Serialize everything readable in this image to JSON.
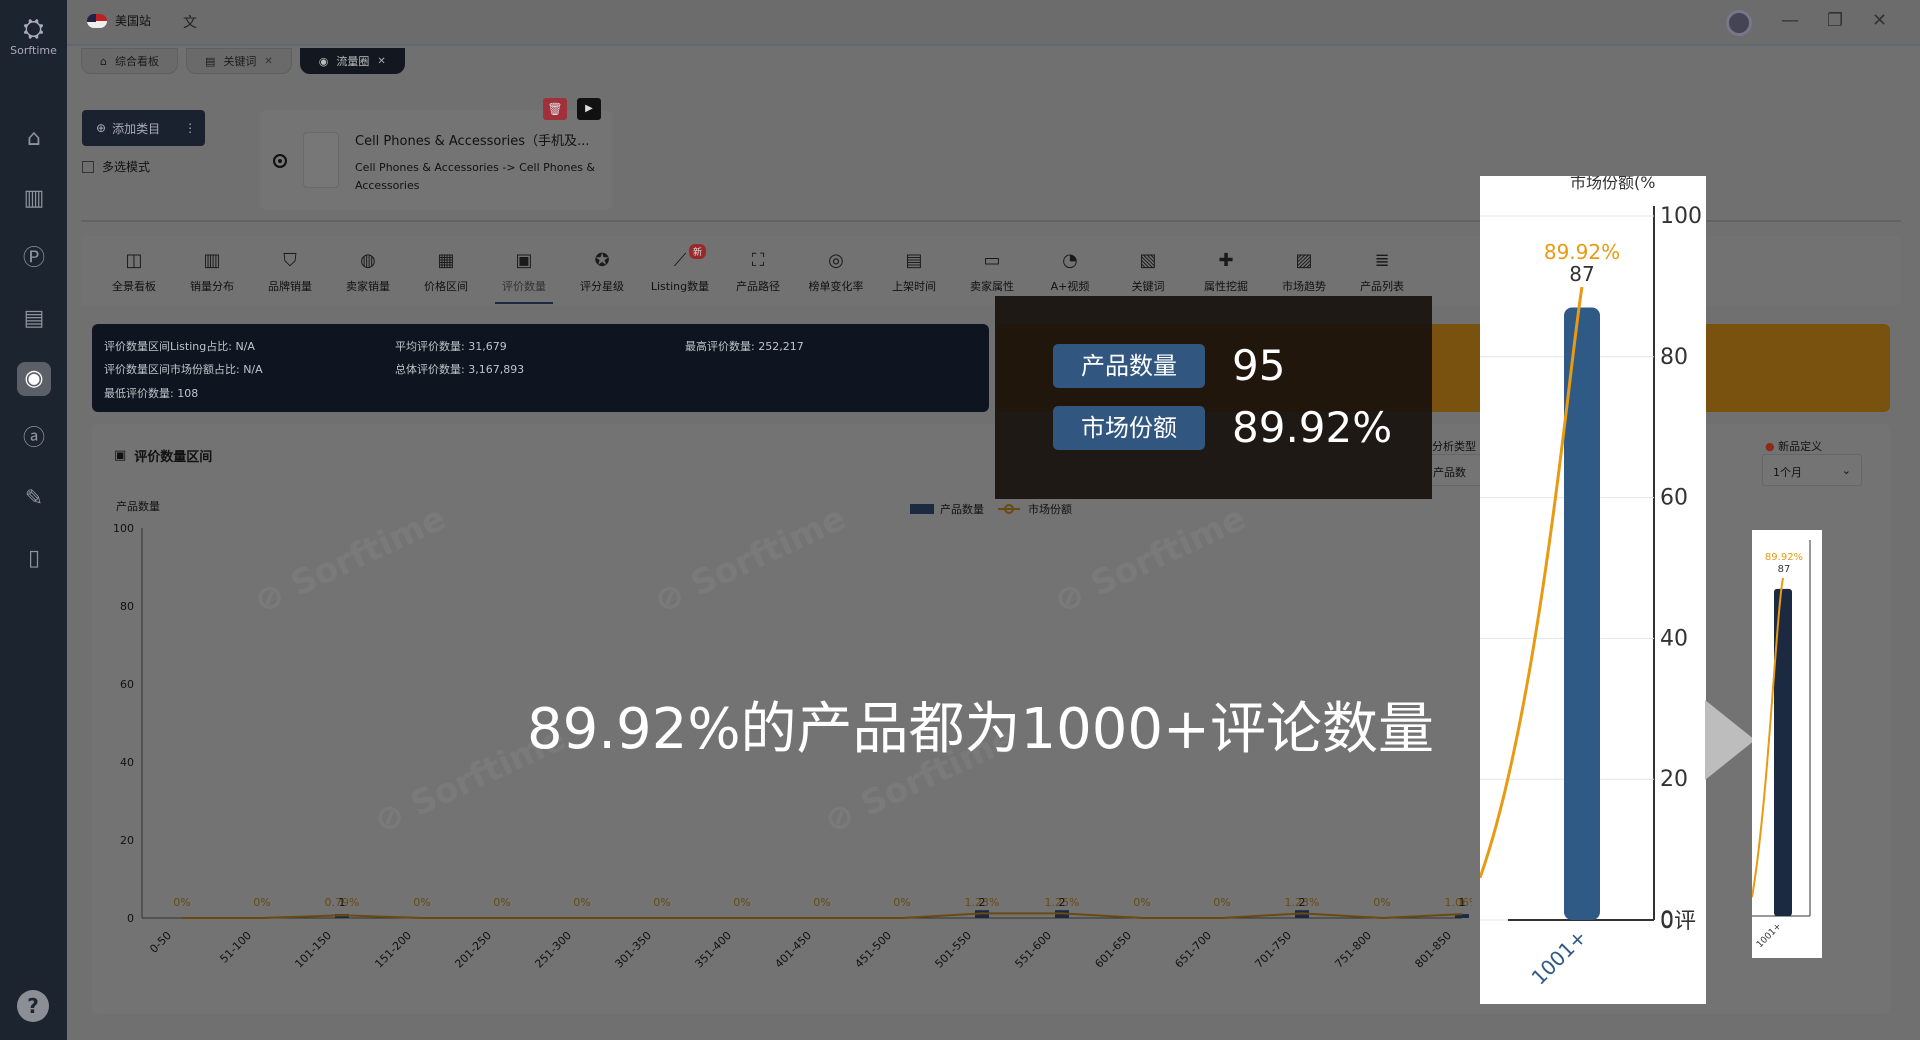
{
  "app": {
    "logo_text": "Sorftime"
  },
  "topbar": {
    "site_label": "美国站"
  },
  "tabs": [
    {
      "label": "综合看板",
      "closable": false
    },
    {
      "label": "关键词",
      "closable": true
    },
    {
      "label": "流量圈",
      "closable": true
    }
  ],
  "category_panel": {
    "add_label": "添加类目",
    "multi_select_label": "多选模式",
    "card_name": "Cell Phones & Accessories（手机及...",
    "card_path": "Cell Phones & Accessories -> Cell Phones & Accessories"
  },
  "feature_tabs": [
    {
      "label": "全景看板",
      "icon": "dashboard-icon"
    },
    {
      "label": "销量分布",
      "icon": "bar-chart-icon"
    },
    {
      "label": "品牌销量",
      "icon": "brand-icon"
    },
    {
      "label": "卖家销量",
      "icon": "seller-icon"
    },
    {
      "label": "价格区间",
      "icon": "price-icon"
    },
    {
      "label": "评价数量",
      "icon": "review-icon",
      "active": true
    },
    {
      "label": "评分星级",
      "icon": "star-icon"
    },
    {
      "label": "Listing数量",
      "icon": "trend-icon",
      "badge": "新"
    },
    {
      "label": "产品路径",
      "icon": "hierarchy-icon"
    },
    {
      "label": "榜单变化率",
      "icon": "rank-icon"
    },
    {
      "label": "上架时间",
      "icon": "calendar-icon"
    },
    {
      "label": "卖家属性",
      "icon": "seller-attr-icon"
    },
    {
      "label": "A+视频",
      "icon": "video-icon"
    },
    {
      "label": "关键词",
      "icon": "keyword-icon"
    },
    {
      "label": "属性挖掘",
      "icon": "puzzle-icon"
    },
    {
      "label": "市场趋势",
      "icon": "market-icon"
    },
    {
      "label": "产品列表",
      "icon": "list-icon"
    }
  ],
  "stats": {
    "listing_ratio": "评价数量区间Listing占比: N/A",
    "share_ratio": "评价数量区间市场份额占比: N/A",
    "min_reviews": "最低评价数量: 108",
    "avg_reviews": "平均评价数量: 31,679",
    "total_reviews": "总体评价数量: 3,167,893",
    "max_reviews": "最高评价数量: 252,217"
  },
  "panel": {
    "title": "评价数量区间",
    "analysis_type_label": "分析类型",
    "analysis_type_value": "产品数",
    "new_product_label": "新品定义",
    "new_product_value": "1个月"
  },
  "chart_data": {
    "type": "bar",
    "ylabel_left": "产品数量",
    "ylabel_right": "市场份额(%)",
    "xlabel_right": "评价数量",
    "legend": [
      "产品数量",
      "市场份额"
    ],
    "ylim_left": [
      0,
      100
    ],
    "ylim_right": [
      0,
      100
    ],
    "yticks": [
      0,
      20,
      40,
      60,
      80,
      100
    ],
    "categories": [
      "0-50",
      "51-100",
      "101-150",
      "151-200",
      "201-250",
      "251-300",
      "301-350",
      "351-400",
      "401-450",
      "451-500",
      "501-550",
      "551-600",
      "601-650",
      "651-700",
      "701-750",
      "751-800",
      "801-850",
      "1001+"
    ],
    "series": [
      {
        "name": "产品数量",
        "values": [
          0,
          0,
          1,
          0,
          0,
          0,
          0,
          0,
          0,
          0,
          2,
          2,
          0,
          0,
          2,
          0,
          1,
          87
        ]
      },
      {
        "name": "市场份额",
        "values": [
          0,
          0,
          0.7,
          0,
          0,
          0,
          0,
          0,
          0,
          0,
          1.2,
          1.2,
          0,
          0,
          1.2,
          0,
          1.0,
          89.92
        ]
      }
    ],
    "bar_labels": [
      "",
      "",
      "1",
      "",
      "",
      "",
      "",
      "",
      "",
      "",
      "2",
      "2",
      "",
      "",
      "2",
      "",
      "1",
      "87"
    ],
    "share_labels": [
      "0%",
      "0%",
      "0.79%",
      "0%",
      "0%",
      "0%",
      "0%",
      "0%",
      "0%",
      "0%",
      "1.23%",
      "1.25%",
      "0%",
      "0%",
      "1.23%",
      "0%",
      "1.06%",
      "89.92%"
    ]
  },
  "tooltip": {
    "count_label": "产品数量",
    "count_value": "95",
    "share_label": "市场份额",
    "share_value": "89.92%"
  },
  "zoom": {
    "axis_title": "市场份额(%",
    "bar_label": "87",
    "share_label": "89.92%",
    "category": "1001+",
    "axis_bottom": "0评"
  },
  "caption": "89.92%的产品都为1000+评论数量",
  "colors": {
    "bar": "#2f5a86",
    "line": "#e89a12",
    "sidebar": "#1c2430"
  }
}
